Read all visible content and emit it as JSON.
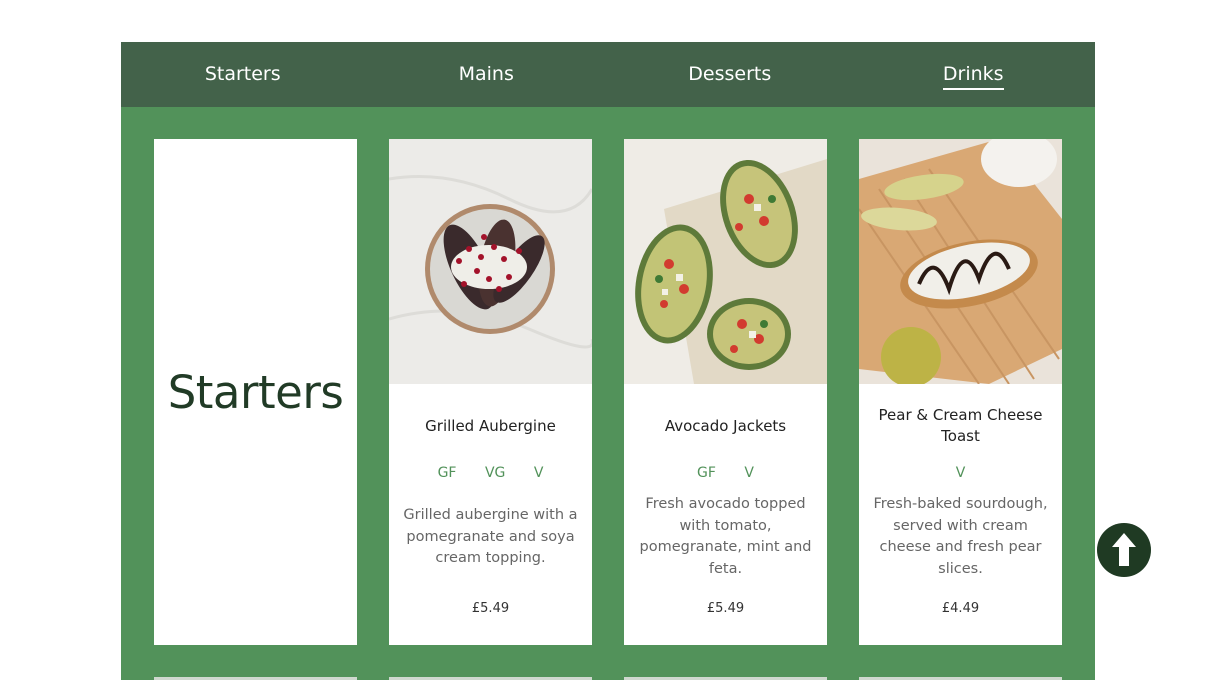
{
  "nav": {
    "tabs": [
      {
        "label": "Starters",
        "active": false
      },
      {
        "label": "Mains",
        "active": false
      },
      {
        "label": "Desserts",
        "active": false
      },
      {
        "label": "Drinks",
        "active": true
      }
    ]
  },
  "section": {
    "title": "Starters"
  },
  "dishes": [
    {
      "name": "Grilled Aubergine",
      "tags": [
        "GF",
        "VG",
        "V"
      ],
      "description": "Grilled aubergine with a pomegranate and soya cream topping.",
      "price": "£5.49"
    },
    {
      "name": "Avocado Jackets",
      "tags": [
        "GF",
        "V"
      ],
      "description": "Fresh avocado topped with tomato, pomegranate, mint and feta.",
      "price": "£5.49"
    },
    {
      "name": "Pear & Cream Cheese Toast",
      "tags": [
        "V"
      ],
      "description": "Fresh-baked sourdough, served with cream cheese and fresh pear slices.",
      "price": "£4.49"
    }
  ],
  "icons": {
    "back_to_top": "arrow-up-icon"
  },
  "colors": {
    "menu_background": "#52925a",
    "tab_bar": "#43624a",
    "accent_tag": "#52925a",
    "back_to_top_button": "#1f3a23"
  }
}
